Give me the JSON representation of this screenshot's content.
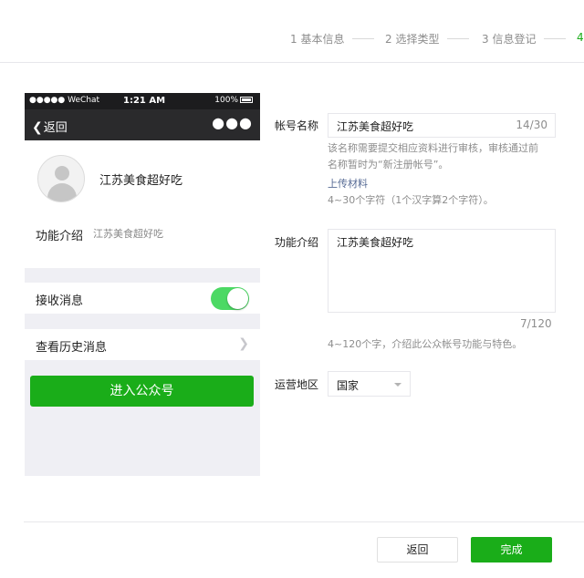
{
  "steps": [
    {
      "label": "1 基本信息"
    },
    {
      "label": "2 选择类型"
    },
    {
      "label": "3 信息登记"
    },
    {
      "label": "4"
    }
  ],
  "phone": {
    "status": {
      "carrier": "●●●●● WeChat",
      "time": "1:21 AM",
      "battery": "100%"
    },
    "nav": {
      "back": "返回",
      "more": "●●●"
    },
    "profile_name": "江苏美食超好吃",
    "intro_label": "功能介绍",
    "intro_value": "江苏美食超好吃",
    "receive_label": "接收消息",
    "receive_on": true,
    "history_label": "查看历史消息",
    "enter_button": "进入公众号"
  },
  "form": {
    "name": {
      "label": "帐号名称",
      "value": "江苏美食超好吃",
      "counter": "14/30",
      "tip_line1": "该名称需要提交相应资料进行审核，审核通过前",
      "tip_line2": "名称暂时为“新注册帐号”。",
      "upload_link": "上传材料",
      "rule": "4~30个字符（1个汉字算2个字符）。"
    },
    "intro": {
      "label": "功能介绍",
      "value": "江苏美食超好吃",
      "counter": "7/120",
      "rule": "4~120个字，介绍此公众帐号功能与特色。"
    },
    "region": {
      "label": "运营地区",
      "value": "国家"
    }
  },
  "footer": {
    "back_button": "返回",
    "done_button": "完成"
  },
  "colors": {
    "accent": "#1aad19",
    "link": "#576b95",
    "muted": "#8d8d8d",
    "toggle_on": "#4cd964"
  }
}
